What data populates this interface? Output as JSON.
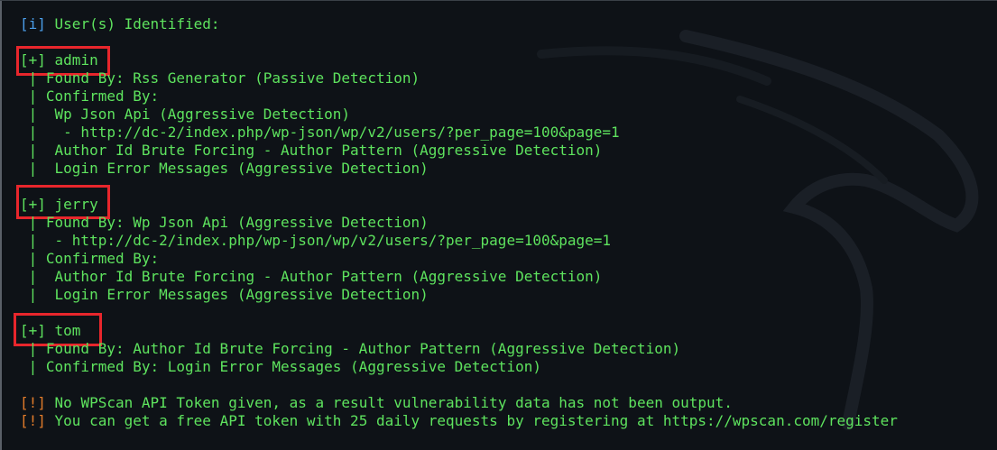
{
  "header": {
    "tag": "[i]",
    "text": " User(s) Identified:"
  },
  "users": [
    {
      "tag": "[+]",
      "name": " admin",
      "details": [
        " | Found By: Rss Generator (Passive Detection)",
        " | Confirmed By:",
        " |  Wp Json Api (Aggressive Detection)",
        " |   - http://dc-2/index.php/wp-json/wp/v2/users/?per_page=100&page=1",
        " |  Author Id Brute Forcing - Author Pattern (Aggressive Detection)",
        " |  Login Error Messages (Aggressive Detection)"
      ]
    },
    {
      "tag": "[+]",
      "name": " jerry",
      "details": [
        " | Found By: Wp Json Api (Aggressive Detection)",
        " |  - http://dc-2/index.php/wp-json/wp/v2/users/?per_page=100&page=1",
        " | Confirmed By:",
        " |  Author Id Brute Forcing - Author Pattern (Aggressive Detection)",
        " |  Login Error Messages (Aggressive Detection)"
      ]
    },
    {
      "tag": "[+]",
      "name": " tom",
      "details": [
        " | Found By: Author Id Brute Forcing - Author Pattern (Aggressive Detection)",
        " | Confirmed By: Login Error Messages (Aggressive Detection)"
      ]
    }
  ],
  "warnings": [
    {
      "tag": "[!]",
      "text": " No WPScan API Token given, as a result vulnerability data has not been output."
    },
    {
      "tag": "[!]",
      "text": " You can get a free API token with 25 daily requests by registering at https://wpscan.com/register"
    }
  ],
  "colors": {
    "background": "#0e1217",
    "info": "#4a9de8",
    "success": "#5ee35e",
    "warning": "#e07b2a",
    "highlight_box": "#e8262c"
  }
}
